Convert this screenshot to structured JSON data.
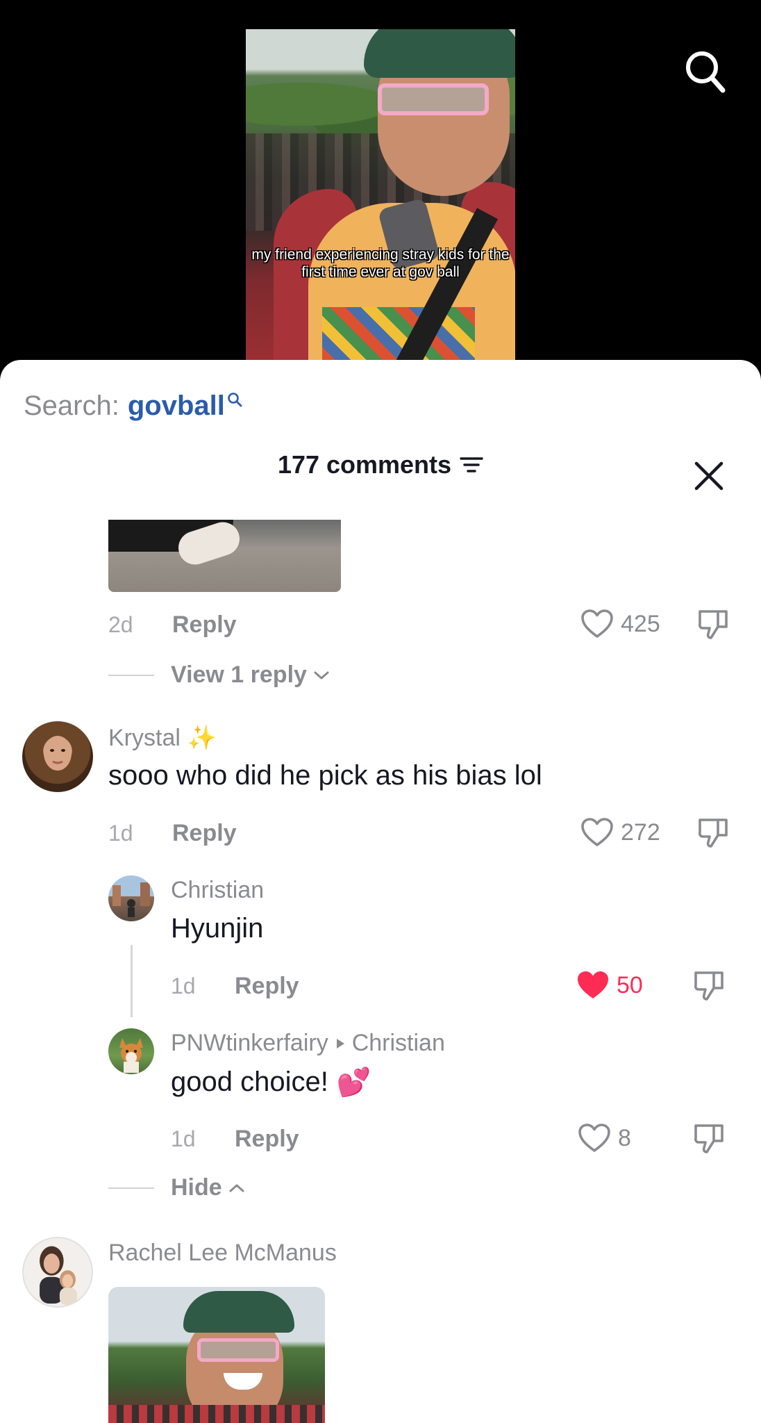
{
  "video": {
    "caption": "my friend experiencing stray kids for the first time ever at gov ball"
  },
  "top_bar": {
    "search_icon": "search-icon"
  },
  "sheet": {
    "search_label": "Search:",
    "search_keyword": "govball",
    "comment_count": "177 comments",
    "sort_icon": "sort-filter-icon",
    "close_icon": "close-icon"
  },
  "comments": [
    {
      "time": "2d",
      "reply_label": "Reply",
      "likes": "425",
      "liked": false,
      "view_replies": "View 1 reply"
    },
    {
      "username": "Krystal",
      "username_emoji": "✨",
      "text": "sooo who did he pick as his bias lol",
      "time": "1d",
      "reply_label": "Reply",
      "likes": "272",
      "liked": false,
      "replies": [
        {
          "username": "Christian",
          "text": "Hyunjin",
          "time": "1d",
          "reply_label": "Reply",
          "likes": "50",
          "liked": true
        },
        {
          "username": "PNWtinkerfairy",
          "reply_to": "Christian",
          "text": "good choice!",
          "text_emoji": "💕",
          "time": "1d",
          "reply_label": "Reply",
          "likes": "8",
          "liked": false
        }
      ],
      "hide_label": "Hide"
    },
    {
      "username": "Rachel Lee McManus"
    }
  ],
  "colors": {
    "accent_like": "#fe2c55",
    "search_keyword": "#2b5cab",
    "muted_text": "#8a8b91"
  }
}
